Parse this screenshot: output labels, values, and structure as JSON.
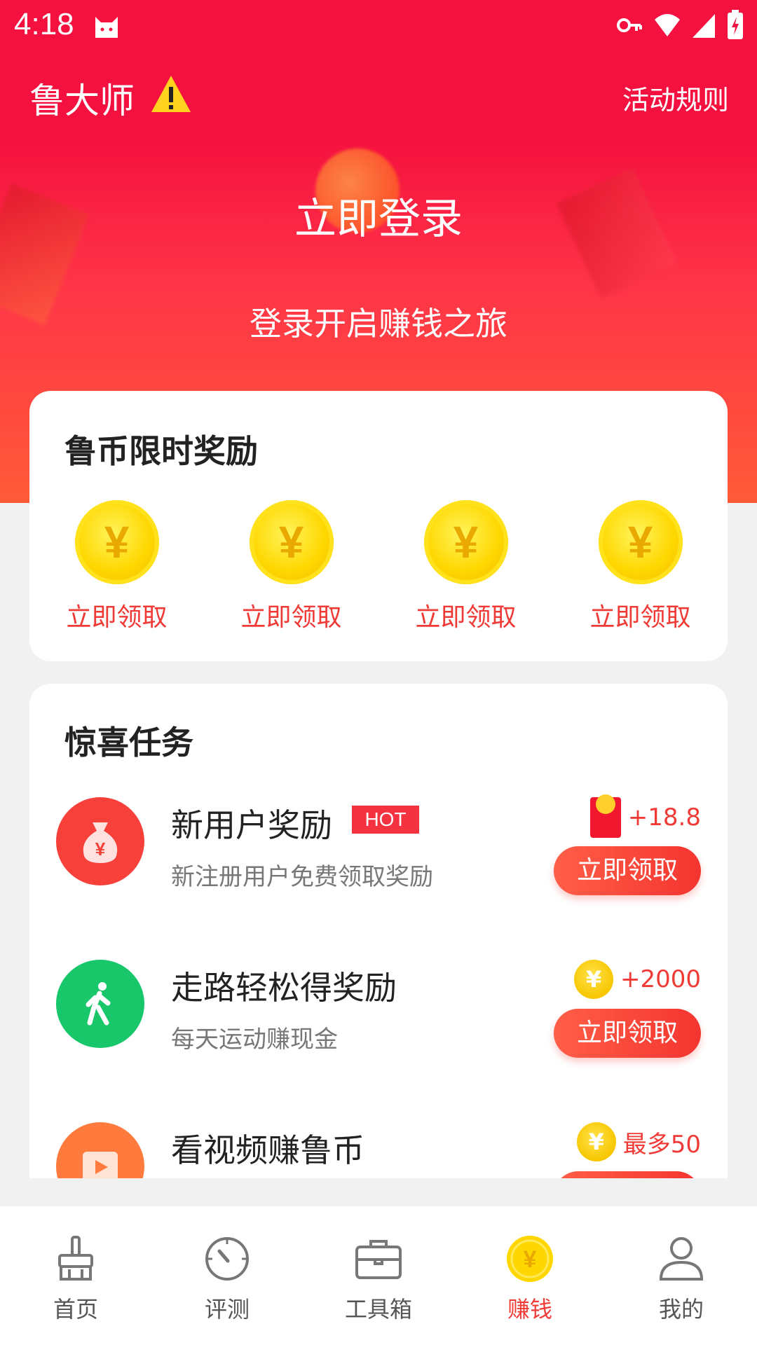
{
  "status_bar": {
    "time": "4:18"
  },
  "header": {
    "title": "鲁大师",
    "rules_link": "活动规则"
  },
  "hero": {
    "login_label": "立即登录",
    "subtitle": "登录开启赚钱之旅"
  },
  "reward_card": {
    "title": "鲁币限时奖励",
    "coins": [
      {
        "label": "立即领取"
      },
      {
        "label": "立即领取"
      },
      {
        "label": "立即领取"
      },
      {
        "label": "立即领取"
      }
    ]
  },
  "task_card": {
    "title": "惊喜任务",
    "tasks": [
      {
        "name": "新用户奖励",
        "badge": "HOT",
        "desc": "新注册用户免费领取奖励",
        "reward": "+18.8",
        "button": "立即领取",
        "icon": "money-bag-icon",
        "color": "#f7403a"
      },
      {
        "name": "走路轻松得奖励",
        "desc": "每天运动赚现金",
        "reward": "+2000",
        "button": "立即领取",
        "icon": "walking-person-icon",
        "color": "#17c769"
      },
      {
        "name": "看视频赚鲁币",
        "reward": "最多50",
        "icon": "video-play-icon",
        "color": "#ff7a3d"
      }
    ]
  },
  "coin_symbol": "¥",
  "bottom_nav": {
    "items": [
      {
        "label": "首页",
        "icon": "broom-icon"
      },
      {
        "label": "评测",
        "icon": "gauge-icon"
      },
      {
        "label": "工具箱",
        "icon": "toolbox-icon"
      },
      {
        "label": "赚钱",
        "icon": "coin-icon",
        "active": true
      },
      {
        "label": "我的",
        "icon": "user-icon"
      }
    ]
  },
  "colors": {
    "brand": "#f5113f",
    "accent": "#f03a36",
    "coin": "#ffd700"
  }
}
